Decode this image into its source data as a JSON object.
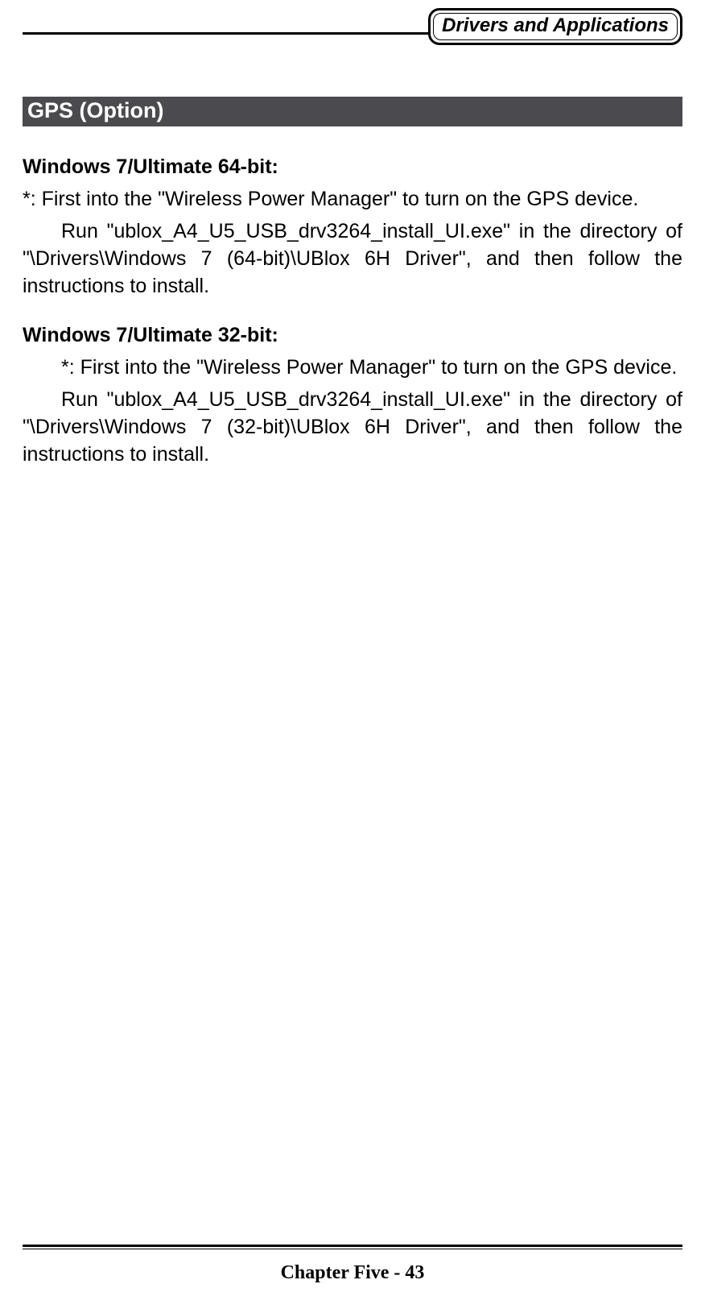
{
  "header": {
    "label": "Drivers and Applications"
  },
  "section": {
    "title": "GPS (Option)"
  },
  "blocks": [
    {
      "heading": "Windows 7/Ultimate 64-bit:",
      "note": "*: First into the \"Wireless Power Manager\" to turn on the GPS device.",
      "body": "Run \"ublox_A4_U5_USB_drv3264_install_UI.exe\" in the directory of \"\\Drivers\\Windows 7 (64-bit)\\UBlox 6H Driver\", and then follow the instructions to install."
    },
    {
      "heading": "Windows 7/Ultimate 32-bit:",
      "note": "*: First into the \"Wireless Power Manager\" to turn on the GPS device.",
      "body": "Run \"ublox_A4_U5_USB_drv3264_install_UI.exe\" in the directory of \"\\Drivers\\Windows 7 (32-bit)\\UBlox 6H Driver\", and then follow the instructions to install."
    }
  ],
  "footer": {
    "text": "Chapter Five - 43"
  }
}
